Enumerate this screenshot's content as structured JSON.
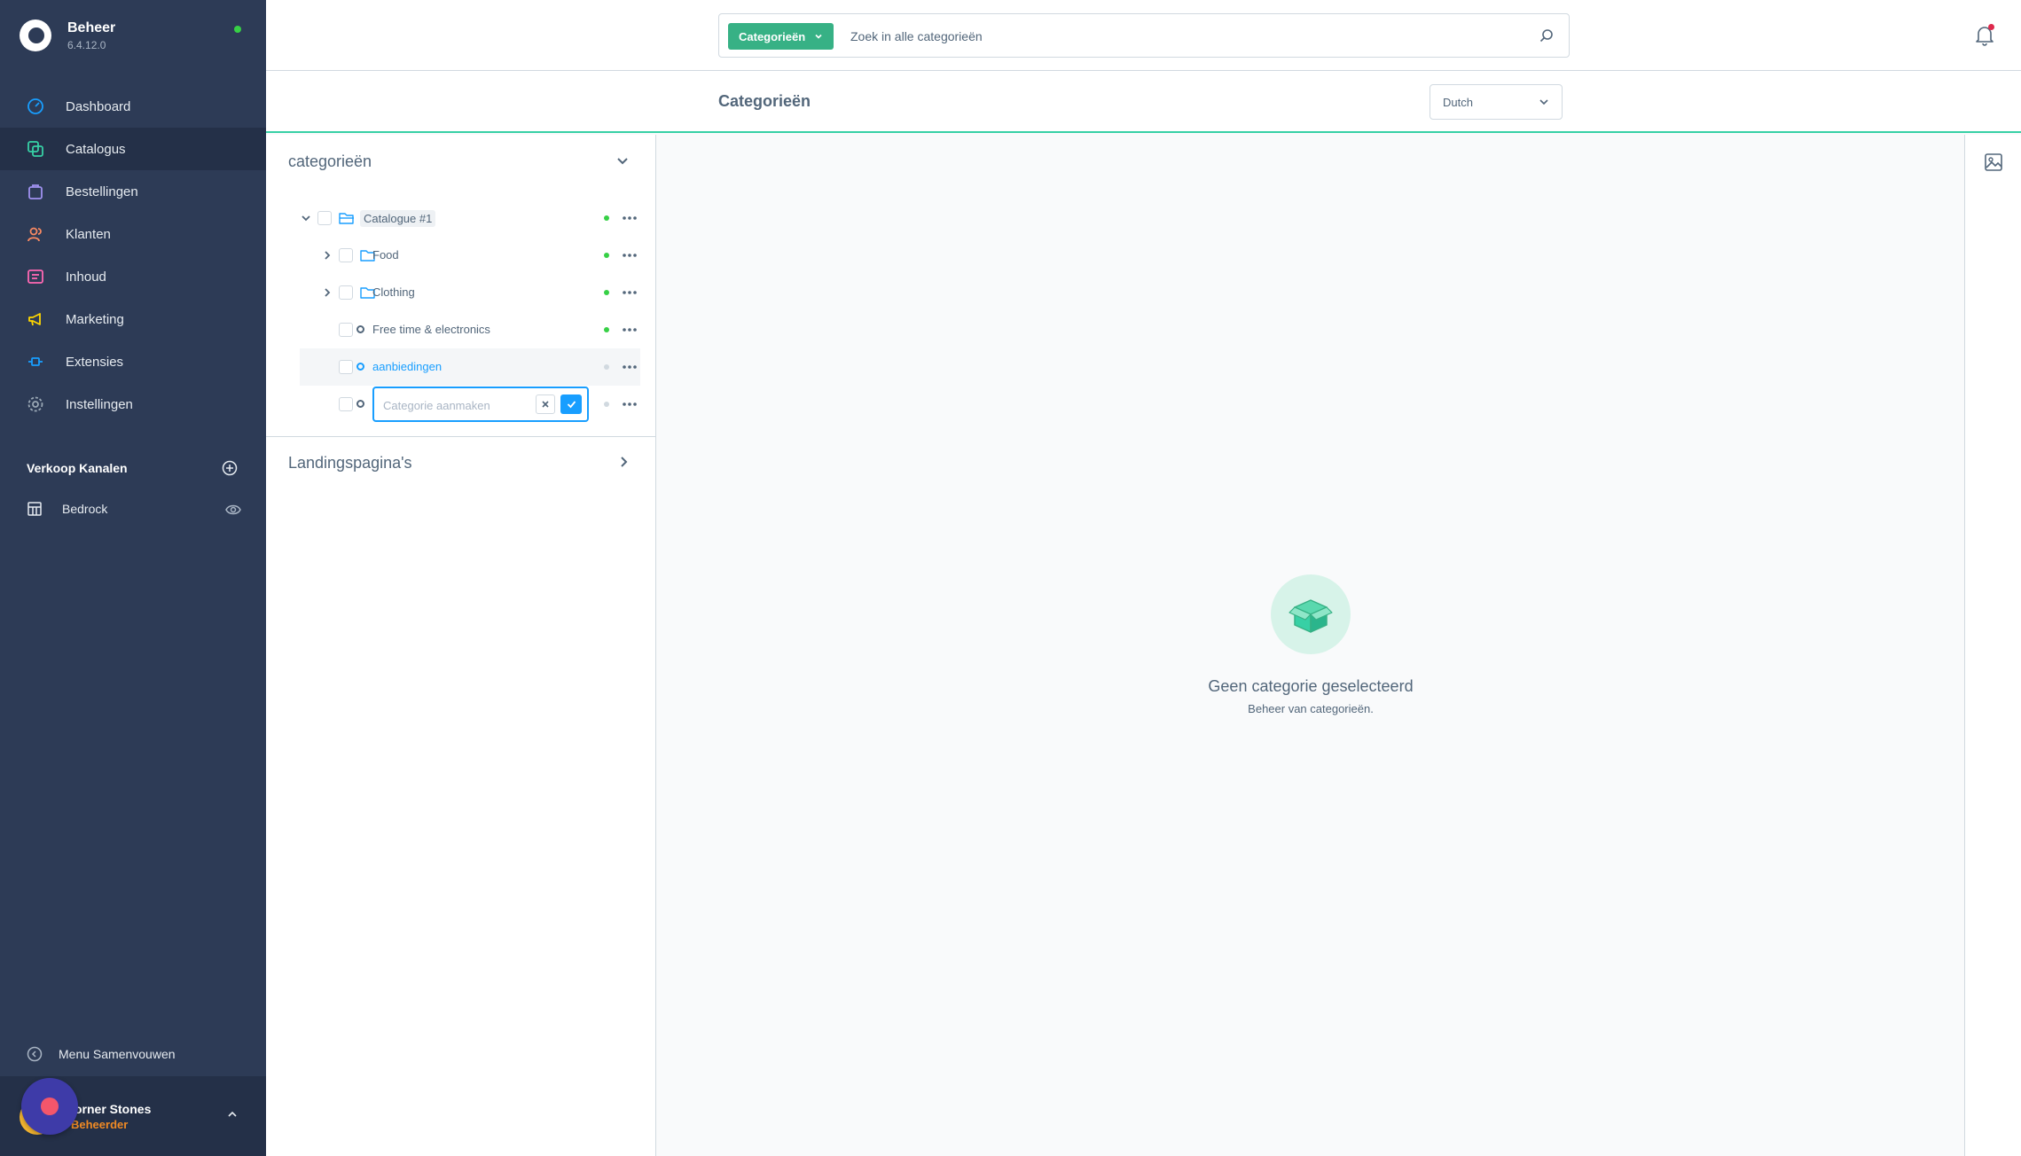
{
  "brand": {
    "title": "Beheer",
    "version": "6.4.12.0"
  },
  "nav": [
    {
      "label": "Dashboard",
      "icon": "dashboard-icon",
      "color": "#189eff"
    },
    {
      "label": "Catalogus",
      "icon": "catalog-icon",
      "color": "#37d0a5"
    },
    {
      "label": "Bestellingen",
      "icon": "orders-icon",
      "color": "#a092f0"
    },
    {
      "label": "Klanten",
      "icon": "customers-icon",
      "color": "#f88962"
    },
    {
      "label": "Inhoud",
      "icon": "content-icon",
      "color": "#ff68b4"
    },
    {
      "label": "Marketing",
      "icon": "marketing-icon",
      "color": "#ffd700"
    },
    {
      "label": "Extensies",
      "icon": "extensions-icon",
      "color": "#189eff"
    },
    {
      "label": "Instellingen",
      "icon": "settings-icon",
      "color": "#9aa8b5"
    }
  ],
  "sales_channels": {
    "title": "Verkoop Kanalen",
    "items": [
      {
        "label": "Bedrock"
      }
    ]
  },
  "collapse_label": "Menu Samenvouwen",
  "user": {
    "name": "orner Stones",
    "role": "Beheerder"
  },
  "search": {
    "type_label": "Categorieën",
    "placeholder": "Zoek in alle categorieën"
  },
  "smartbar": {
    "title": "Categorieën",
    "language": "Dutch"
  },
  "tree": {
    "section_title": "categorieën",
    "landing_title": "Landingspagina's",
    "rows": [
      {
        "label": "Catalogue #1",
        "active": true
      },
      {
        "label": "Food",
        "active": true
      },
      {
        "label": "Clothing",
        "active": true
      },
      {
        "label": "Free time & electronics",
        "active": true
      },
      {
        "label": "aanbiedingen",
        "active": false
      }
    ],
    "new_placeholder": "Categorie aanmaken"
  },
  "empty_state": {
    "title": "Geen categorie geselecteerd",
    "subtitle": "Beheer van categorieën."
  },
  "colors": {
    "sidebar": "#2d3b56",
    "accent": "#37d0a5",
    "link": "#189eff",
    "active_dot": "#37d046"
  }
}
